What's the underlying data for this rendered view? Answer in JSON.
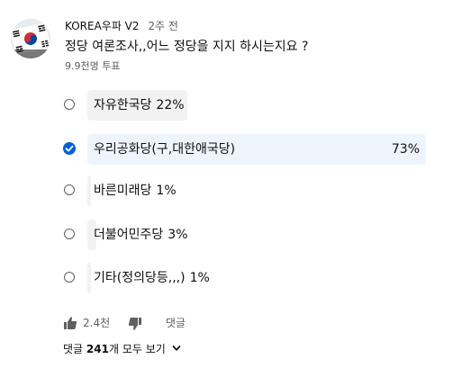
{
  "post": {
    "channel_name": "KOREA우파 V2",
    "time_ago": "2주 전",
    "question": "정당 여론조사,,어느 정당을 지지 하시는지요 ?",
    "vote_count": "9.9천명 투표"
  },
  "poll": {
    "options": [
      {
        "label": "자유한국당",
        "percent": "22%",
        "value": 22,
        "selected": false
      },
      {
        "label": "우리공화당(구,대한애국당)",
        "percent": "73%",
        "value": 73,
        "selected": true
      },
      {
        "label": "바른미래당",
        "percent": "1%",
        "value": 1,
        "selected": false
      },
      {
        "label": "더불어민주당",
        "percent": "3%",
        "value": 3,
        "selected": false
      },
      {
        "label": "기타(정의당등,,,)",
        "percent": "1%",
        "value": 1,
        "selected": false
      }
    ]
  },
  "actions": {
    "like_count": "2.4천",
    "reply_label": "댓글",
    "like_icon": "thumbs-up-icon",
    "dislike_icon": "thumbs-down-icon"
  },
  "comments": {
    "prefix": "댓글",
    "count": "241",
    "suffix": "개 모두 보기"
  },
  "colors": {
    "accent": "#065fd4",
    "bar": "#f2f2f2",
    "selected_bar": "#eef4fc",
    "secondary_text": "#606060"
  }
}
